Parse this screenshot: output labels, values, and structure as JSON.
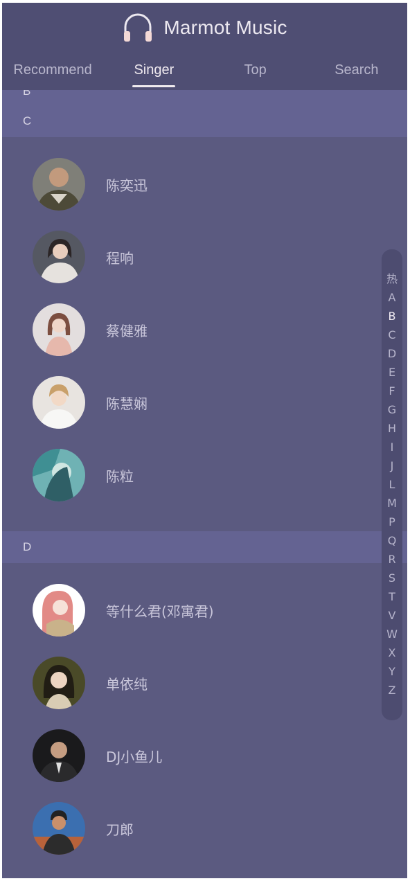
{
  "app": {
    "title": "Marmot Music"
  },
  "tabs": [
    {
      "label": "Recommend",
      "active": false
    },
    {
      "label": "Singer",
      "active": true
    },
    {
      "label": "Top",
      "active": false
    },
    {
      "label": "Search",
      "active": false
    }
  ],
  "list": {
    "previous_group": "B",
    "groups": [
      {
        "letter": "C",
        "singers": [
          "陈奕迅",
          "程响",
          "蔡健雅",
          "陈慧娴",
          "陈粒"
        ]
      },
      {
        "letter": "D",
        "singers": [
          "等什么君(邓寓君)",
          "单依纯",
          "DJ小鱼儿",
          "刀郎"
        ]
      }
    ]
  },
  "index": {
    "items": [
      "热",
      "A",
      "B",
      "C",
      "D",
      "E",
      "F",
      "G",
      "H",
      "I",
      "J",
      "L",
      "M",
      "P",
      "Q",
      "R",
      "S",
      "T",
      "V",
      "W",
      "X",
      "Y",
      "Z"
    ],
    "active": "B"
  },
  "colors": {
    "background": "#5b5a80",
    "header": "#4f4e73",
    "group_header": "#646392",
    "index_bar": "#4d4c70",
    "text": "#c9c6da"
  },
  "icons": {
    "brand": "headphones-icon"
  }
}
